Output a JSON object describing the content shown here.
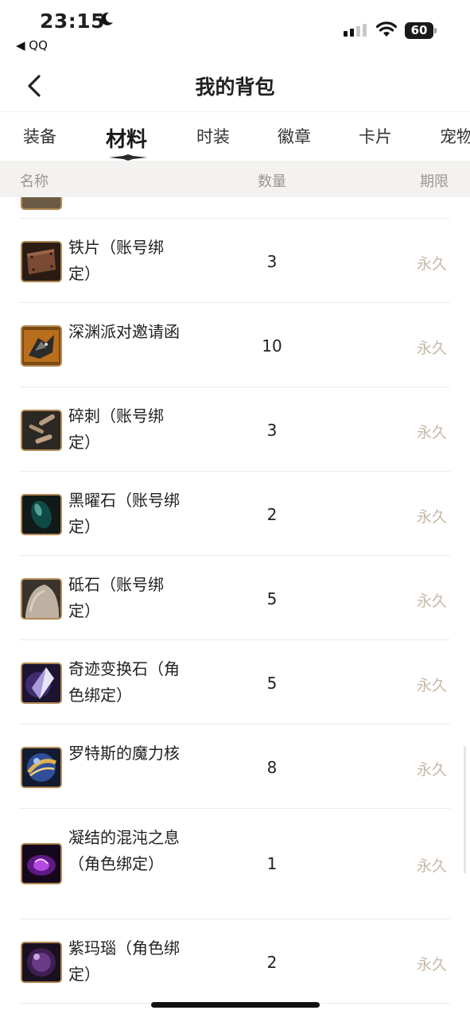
{
  "status_bar": {
    "time": "23:15",
    "back_app": "◀ QQ",
    "battery": "60"
  },
  "header": {
    "title": "我的背包"
  },
  "tabs": [
    {
      "label": "装备",
      "active": false
    },
    {
      "label": "材料",
      "active": true
    },
    {
      "label": "时装",
      "active": false
    },
    {
      "label": "徽章",
      "active": false
    },
    {
      "label": "卡片",
      "active": false
    },
    {
      "label": "宠物",
      "active": false
    }
  ],
  "columns": {
    "name": "名称",
    "quantity": "数量",
    "expiry": "期限"
  },
  "items": [
    {
      "name": "铁片（账号绑定）",
      "quantity": "3",
      "expiry": "永久",
      "icon": "iron-plate-icon"
    },
    {
      "name": "深渊派对邀请函",
      "quantity": "10",
      "expiry": "永久",
      "icon": "abyss-invitation-icon"
    },
    {
      "name": "碎刺（账号绑定）",
      "quantity": "3",
      "expiry": "永久",
      "icon": "broken-thorn-icon"
    },
    {
      "name": "黑曜石（账号绑定）",
      "quantity": "2",
      "expiry": "永久",
      "icon": "obsidian-icon"
    },
    {
      "name": "砥石（账号绑定）",
      "quantity": "5",
      "expiry": "永久",
      "icon": "whetstone-icon"
    },
    {
      "name": "奇迹变换石（角色绑定）",
      "quantity": "5",
      "expiry": "永久",
      "icon": "miracle-stone-icon"
    },
    {
      "name": "罗特斯的魔力核",
      "quantity": "8",
      "expiry": "永久",
      "icon": "magic-core-icon"
    },
    {
      "name": "凝结的混沌之息（角色绑定）",
      "quantity": "1",
      "expiry": "永久",
      "icon": "chaos-breath-icon"
    },
    {
      "name": "紫玛瑙（角色绑定）",
      "quantity": "2",
      "expiry": "永久",
      "icon": "purple-agate-icon"
    }
  ]
}
